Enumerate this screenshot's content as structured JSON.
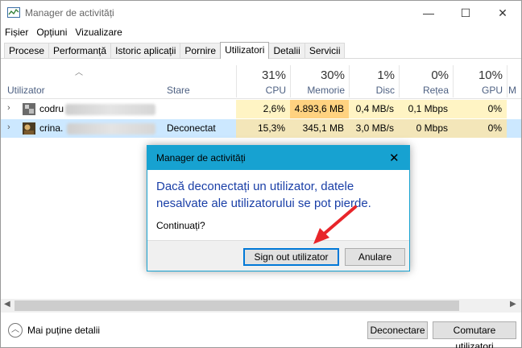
{
  "window": {
    "title": "Manager de activități",
    "min_glyph": "—",
    "max_glyph": "☐",
    "close_glyph": "✕"
  },
  "menu": [
    "Fișier",
    "Opțiuni",
    "Vizualizare"
  ],
  "tabs": [
    "Procese",
    "Performanță",
    "Istoric aplicații",
    "Pornire",
    "Utilizatori",
    "Detalii",
    "Servicii"
  ],
  "active_tab": "Utilizatori",
  "columns": {
    "user": "Utilizator",
    "state": "Stare",
    "cpu": {
      "pct": "31%",
      "label": "CPU"
    },
    "memory": {
      "pct": "30%",
      "label": "Memorie"
    },
    "disk": {
      "pct": "1%",
      "label": "Disc"
    },
    "network": {
      "pct": "0%",
      "label": "Rețea"
    },
    "gpu": {
      "pct": "10%",
      "label": "GPU"
    },
    "more": "M"
  },
  "rows": [
    {
      "name": "codru",
      "state": "",
      "cpu": "2,6%",
      "memory": "4.893,6 MB",
      "disk": "0,4 MB/s",
      "network": "0,1 Mbps",
      "gpu": "0%"
    },
    {
      "name": "crina.",
      "state": "Deconectat",
      "cpu": "15,3%",
      "memory": "345,1 MB",
      "disk": "3,0 MB/s",
      "network": "0 Mbps",
      "gpu": "0%"
    }
  ],
  "bottom": {
    "fewer_details": "Mai puține detalii",
    "disconnect": "Deconectare",
    "switch_user": "Comutare utilizatori"
  },
  "dialog": {
    "title": "Manager de activități",
    "message": "Dacă deconectați un utilizator, datele nesalvate ale utilizatorului se pot pierde.",
    "question": "Continuați?",
    "sign_out": "Sign out utilizator",
    "cancel": "Anulare",
    "close_glyph": "✕"
  },
  "colors": {
    "dialog_accent": "#17a2d1",
    "message_text": "#1a3fa7",
    "heat_low": "#fff4c4",
    "heat_mid": "#ffe9a7",
    "heat_high": "#ffd280",
    "selected_row": "#cce8ff",
    "arrow": "#e8252a"
  }
}
